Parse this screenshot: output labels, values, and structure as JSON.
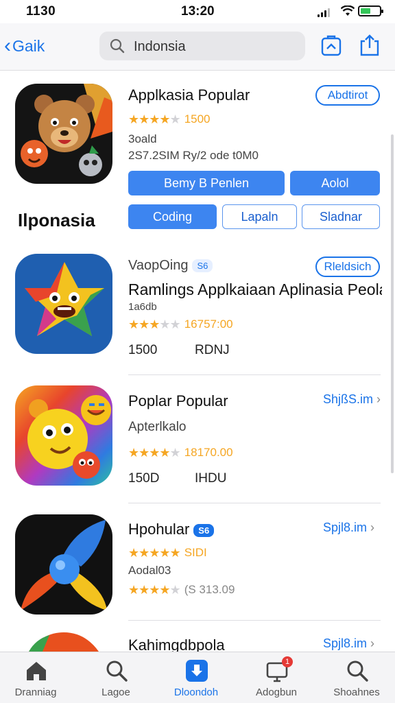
{
  "status_bar": {
    "left": "1130",
    "time": "13:20"
  },
  "nav": {
    "back_label": "Gaik",
    "search_value": "Indonsia",
    "icons": [
      "share-box-icon",
      "upload-icon"
    ]
  },
  "side_label": "Ilponasia",
  "apps": [
    {
      "title": "Applkasia Popular",
      "action": "Abdtirot",
      "rating_stars": 4,
      "rating_text": "1500",
      "subtitle": "3oald",
      "meta": "2S7.2SIM    Ry/2  ode    t0M0",
      "buttons_solid": [
        "Bemy      B Penlen",
        "Aolol"
      ],
      "button_active": "Coding",
      "buttons_ghost": [
        "Lapaln",
        "Sladnar"
      ]
    },
    {
      "title": "VaopOing",
      "badge": "S6",
      "action": "Rleldsich",
      "headline": "Ramlings Applkaiaan Aplinasia Peolan",
      "subtitle": "1a6db",
      "rating_stars": 3,
      "rating_text": "16757:00",
      "meta_a": "1500",
      "meta_b": "RDNJ"
    },
    {
      "title": "Poplar Popular",
      "action": "ShjßS.im",
      "subtitle": "Apterlkalo",
      "rating_stars": 4,
      "rating_text": "18170.00",
      "meta_a": "150D",
      "meta_b": "IHDU"
    },
    {
      "title": "Hpohular",
      "badge": "S6",
      "action": "Spjl8.im",
      "rating_stars": 5,
      "rating_text": "SIDI",
      "subtitle": "Aodal03",
      "rating2_stars": 4,
      "rating2_text": "(S 313.09"
    },
    {
      "title": "Kahimgdbpola",
      "action": "Spjl8.im"
    }
  ],
  "tabs": [
    {
      "label": "Dranniag",
      "icon": "home-icon"
    },
    {
      "label": "Lagoe",
      "icon": "search-icon"
    },
    {
      "label": "Dloondoh",
      "icon": "download-icon",
      "active": true
    },
    {
      "label": "Adogbun",
      "icon": "updates-icon",
      "badge": "1"
    },
    {
      "label": "Shoahnes",
      "icon": "search-icon"
    }
  ],
  "colors": {
    "accent": "#1a73e8",
    "star": "#f5a623",
    "button": "#3d85f0",
    "badge": "#e53935"
  }
}
